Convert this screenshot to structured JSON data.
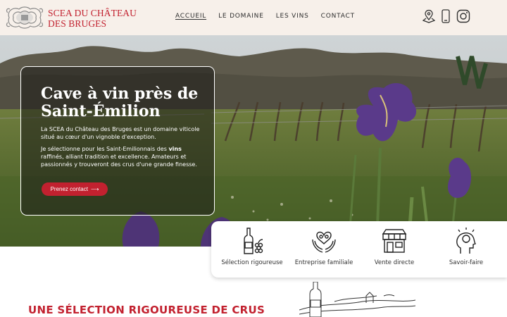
{
  "header": {
    "brand_line1": "SCEA DU CHÂTEAU",
    "brand_line2": "DES BRUGES",
    "nav": [
      {
        "label": "ACCUEIL",
        "active": true
      },
      {
        "label": "LE DOMAINE",
        "active": false
      },
      {
        "label": "LES VINS",
        "active": false
      },
      {
        "label": "CONTACT",
        "active": false
      }
    ],
    "icons": [
      "map-pin-icon",
      "phone-icon",
      "instagram-icon"
    ]
  },
  "hero": {
    "title": "Cave à vin près de Saint-Émilion",
    "paragraph1": "La SCEA du Château des Bruges est un domaine viticole situé au cœur d'un vignoble d'exception.",
    "paragraph2_before": "Je sélectionne pour les Saint-Emilionnais des ",
    "paragraph2_bold": "vins",
    "paragraph2_after": " raffinés, alliant tradition et excellence. Amateurs et passionnés y trouveront des crus d'une grande finesse.",
    "cta_label": "Prenez contact",
    "cta_arrow": "⟶"
  },
  "features": [
    {
      "label": "Sélection rigoureuse",
      "icon": "wine-bottle-icon"
    },
    {
      "label": "Entreprise familiale",
      "icon": "family-hands-icon"
    },
    {
      "label": "Vente directe",
      "icon": "shop-icon"
    },
    {
      "label": "Savoir-faire",
      "icon": "idea-head-icon"
    }
  ],
  "section": {
    "title": "UNE SÉLECTION RIGOUREUSE DE CRUS"
  },
  "colors": {
    "brand": "#c2212f",
    "header_bg": "#f7f0ea"
  }
}
